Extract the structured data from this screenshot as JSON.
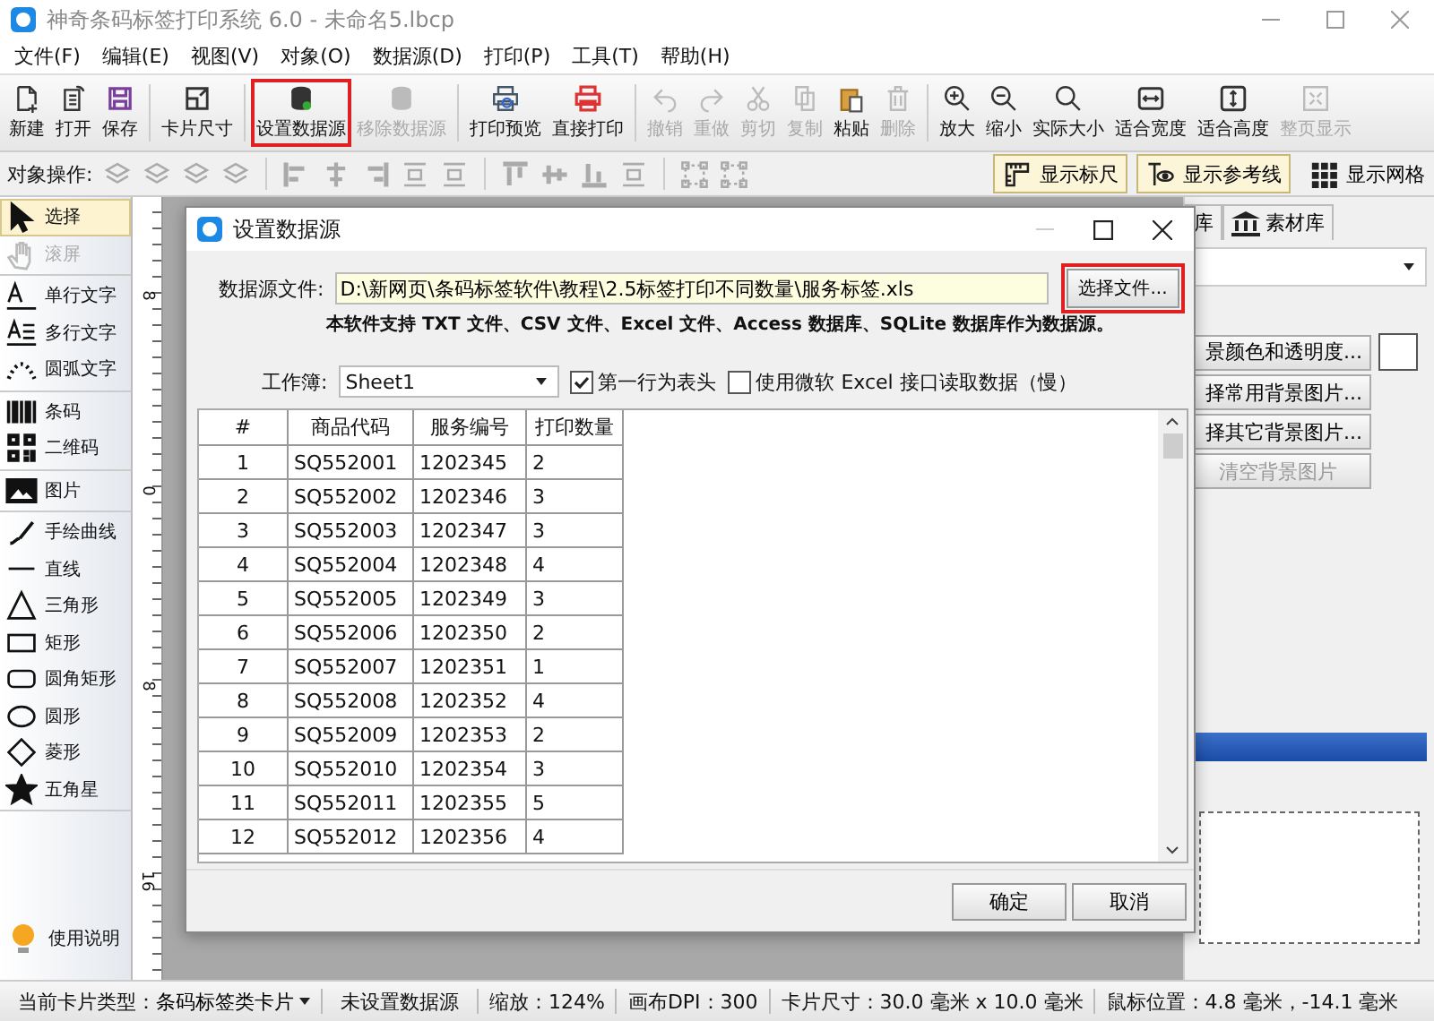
{
  "window": {
    "title": "神奇条码标签打印系统 6.0 - 未命名5.lbcp"
  },
  "menu": [
    "文件(F)",
    "编辑(E)",
    "视图(V)",
    "对象(O)",
    "数据源(D)",
    "打印(P)",
    "工具(T)",
    "帮助(H)"
  ],
  "toolbar_groups": [
    [
      {
        "label": "新建",
        "disabled": false,
        "highlighted": false
      },
      {
        "label": "打开",
        "disabled": false,
        "highlighted": false
      },
      {
        "label": "保存",
        "disabled": false,
        "highlighted": false
      }
    ],
    [
      {
        "label": "卡片尺寸",
        "disabled": false,
        "highlighted": false
      }
    ],
    [
      {
        "label": "设置数据源",
        "disabled": false,
        "highlighted": true
      },
      {
        "label": "移除数据源",
        "disabled": true,
        "highlighted": false
      }
    ],
    [
      {
        "label": "打印预览",
        "disabled": false,
        "highlighted": false
      },
      {
        "label": "直接打印",
        "disabled": false,
        "highlighted": false
      }
    ],
    [
      {
        "label": "撤销",
        "disabled": true,
        "highlighted": false
      },
      {
        "label": "重做",
        "disabled": true,
        "highlighted": false
      },
      {
        "label": "剪切",
        "disabled": true,
        "highlighted": false
      },
      {
        "label": "复制",
        "disabled": true,
        "highlighted": false
      },
      {
        "label": "粘贴",
        "disabled": false,
        "highlighted": false
      },
      {
        "label": "删除",
        "disabled": true,
        "highlighted": false
      }
    ],
    [
      {
        "label": "放大",
        "disabled": false,
        "highlighted": false
      },
      {
        "label": "缩小",
        "disabled": false,
        "highlighted": false
      },
      {
        "label": "实际大小",
        "disabled": false,
        "highlighted": false
      },
      {
        "label": "适合宽度",
        "disabled": false,
        "highlighted": false
      },
      {
        "label": "适合高度",
        "disabled": false,
        "highlighted": false
      },
      {
        "label": "整页显示",
        "disabled": true,
        "highlighted": false
      }
    ]
  ],
  "object_bar": {
    "label": "对象操作:",
    "toggles": [
      {
        "label": "显示标尺",
        "selected": true
      },
      {
        "label": "显示参考线",
        "selected": true
      },
      {
        "label": "显示网格",
        "selected": false
      }
    ]
  },
  "tool_groups": [
    [
      {
        "label": "选择",
        "selected": true,
        "disabled": false
      },
      {
        "label": "滚屏",
        "selected": false,
        "disabled": true
      }
    ],
    [
      {
        "label": "单行文字",
        "selected": false,
        "disabled": false
      },
      {
        "label": "多行文字",
        "selected": false,
        "disabled": false
      },
      {
        "label": "圆弧文字",
        "selected": false,
        "disabled": false
      }
    ],
    [
      {
        "label": "条码",
        "selected": false,
        "disabled": false
      },
      {
        "label": "二维码",
        "selected": false,
        "disabled": false
      }
    ],
    [
      {
        "label": "图片",
        "selected": false,
        "disabled": false
      }
    ],
    [
      {
        "label": "手绘曲线",
        "selected": false,
        "disabled": false
      },
      {
        "label": "直线",
        "selected": false,
        "disabled": false
      },
      {
        "label": "三角形",
        "selected": false,
        "disabled": false
      },
      {
        "label": "矩形",
        "selected": false,
        "disabled": false
      },
      {
        "label": "圆角矩形",
        "selected": false,
        "disabled": false
      },
      {
        "label": "圆形",
        "selected": false,
        "disabled": false
      },
      {
        "label": "菱形",
        "selected": false,
        "disabled": false
      },
      {
        "label": "五角星",
        "selected": false,
        "disabled": false
      }
    ]
  ],
  "help": "使用说明",
  "ruler_labels": [
    "8",
    "0",
    "8",
    "16"
  ],
  "right_panel": {
    "tabs": [
      {
        "label": "库",
        "selected": false
      },
      {
        "label": "素材库",
        "selected": false
      }
    ],
    "buttons": [
      {
        "label": "景颜色和透明度...",
        "disabled": false
      },
      {
        "label": "择常用背景图片...",
        "disabled": false
      },
      {
        "label": "择其它背景图片...",
        "disabled": false
      },
      {
        "label": "清空背景图片",
        "disabled": true
      }
    ]
  },
  "dialog": {
    "title": "设置数据源",
    "file_label": "数据源文件:",
    "file_value": "D:\\新网页\\条码标签软件\\教程\\2.5标签打印不同数量\\服务标签.xls",
    "choose_button": "选择文件...",
    "note": "本软件支持 TXT 文件、CSV 文件、Excel 文件、Access 数据库、SQLite 数据库作为数据源。",
    "workbook_label": "工作簿:",
    "workbook_value": "Sheet1",
    "options": [
      {
        "label": "第一行为表头",
        "checked": true
      },
      {
        "label": "使用微软 Excel 接口读取数据（慢）",
        "checked": false
      }
    ],
    "table": {
      "columns": [
        "#",
        "商品代码",
        "服务编号",
        "打印数量"
      ],
      "rows": [
        [
          "1",
          "SQ552001",
          "1202345",
          "2"
        ],
        [
          "2",
          "SQ552002",
          "1202346",
          "3"
        ],
        [
          "3",
          "SQ552003",
          "1202347",
          "3"
        ],
        [
          "4",
          "SQ552004",
          "1202348",
          "4"
        ],
        [
          "5",
          "SQ552005",
          "1202349",
          "3"
        ],
        [
          "6",
          "SQ552006",
          "1202350",
          "2"
        ],
        [
          "7",
          "SQ552007",
          "1202351",
          "1"
        ],
        [
          "8",
          "SQ552008",
          "1202352",
          "4"
        ],
        [
          "9",
          "SQ552009",
          "1202353",
          "2"
        ],
        [
          "10",
          "SQ552010",
          "1202354",
          "3"
        ],
        [
          "11",
          "SQ552011",
          "1202355",
          "5"
        ],
        [
          "12",
          "SQ552012",
          "1202356",
          "4"
        ]
      ]
    },
    "buttons": [
      "确定",
      "取消"
    ]
  },
  "status_bar": {
    "card_type_label": "当前卡片类型：",
    "card_type": "条码标签类卡片",
    "datasource": "未设置数据源",
    "zoom": "缩放：124%",
    "dpi": "画布DPI：300",
    "card_size": "卡片尺寸：30.0 毫米 x 10.0 毫米",
    "mouse": "鼠标位置：4.8 毫米，-14.1 毫米"
  }
}
